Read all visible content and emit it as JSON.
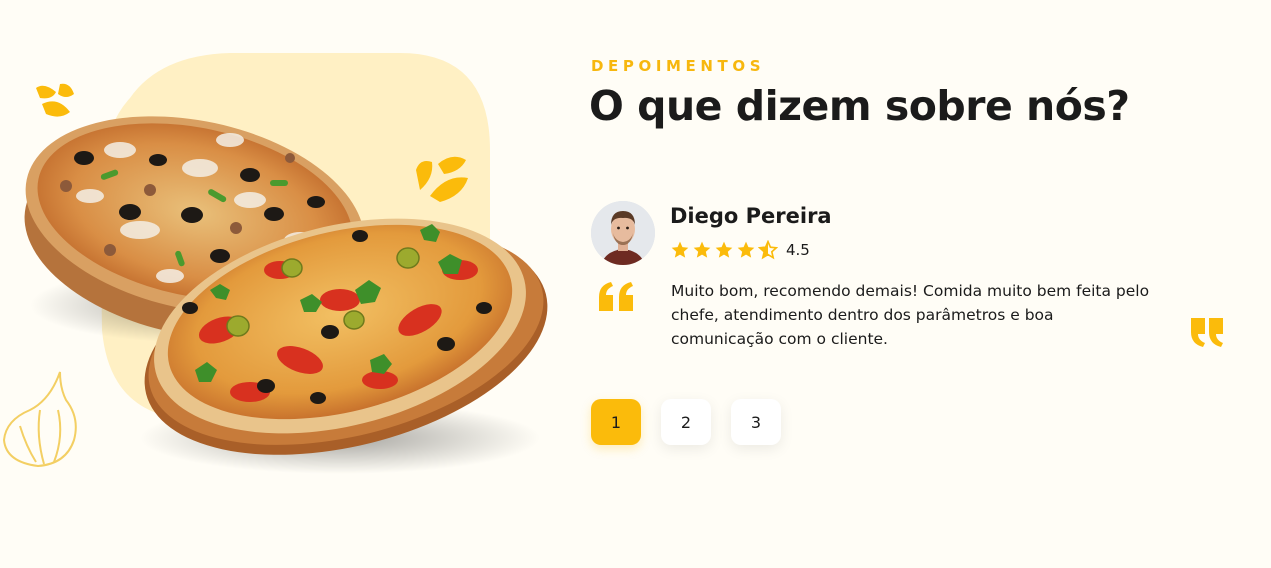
{
  "section": {
    "eyebrow": "DEPOIMENTOS",
    "title": "O que dizem sobre nós?"
  },
  "testimonial": {
    "name": "Diego Pereira",
    "rating": 4.5,
    "rating_label": "4.5",
    "stars": [
      "star-full-icon",
      "star-full-icon",
      "star-full-icon",
      "star-full-icon",
      "star-half-icon"
    ],
    "text": "Muito bom, recomendo demais! Comida muito bem feita pelo chefe, atendimento dentro dos parâmetros e boa comunicação com o cliente."
  },
  "pagination": {
    "pages": [
      "1",
      "2",
      "3"
    ],
    "active": "1"
  },
  "colors": {
    "accent": "#fbbb0b",
    "background": "#fffdf6",
    "blob": "#fff0c4",
    "text": "#1b1b1b"
  },
  "icons": [
    "quote-open-icon",
    "quote-close-icon",
    "splash-icon",
    "garlic-icon"
  ]
}
